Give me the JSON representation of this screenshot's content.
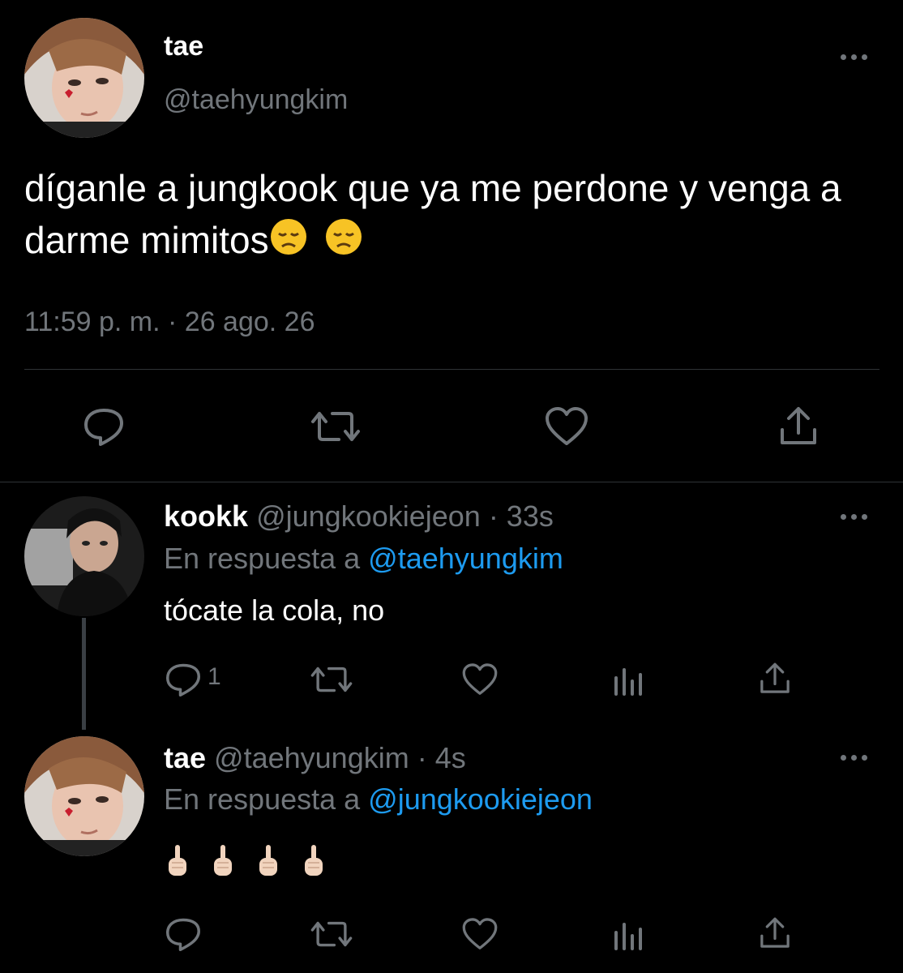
{
  "main_tweet": {
    "display_name": "tae",
    "handle": "@taehyungkim",
    "text": "díganle a jungkook que ya me perdone y venga a darme mimitos",
    "emojis": [
      "disappointed-face-emoji",
      "disappointed-face-emoji"
    ],
    "timestamp": "11:59 p. m. · 26 ago. 26"
  },
  "replies": [
    {
      "display_name": "kookk",
      "handle": "@jungkookiejeon",
      "time": "· 33s",
      "reply_prefix": "En respuesta a",
      "reply_to": "@taehyungkim",
      "text": "tócate la cola, no",
      "reply_count": "1"
    },
    {
      "display_name": "tae",
      "handle": "@taehyungkim",
      "time": "· 4s",
      "reply_prefix": "En respuesta a",
      "reply_to": "@jungkookiejeon",
      "emojis": [
        "middle-finger-emoji",
        "middle-finger-emoji",
        "middle-finger-emoji",
        "middle-finger-emoji"
      ]
    }
  ],
  "colors": {
    "background": "#000000",
    "text": "#ffffff",
    "muted": "#71767b",
    "link": "#1d9bf0",
    "divider": "#2f3336"
  }
}
